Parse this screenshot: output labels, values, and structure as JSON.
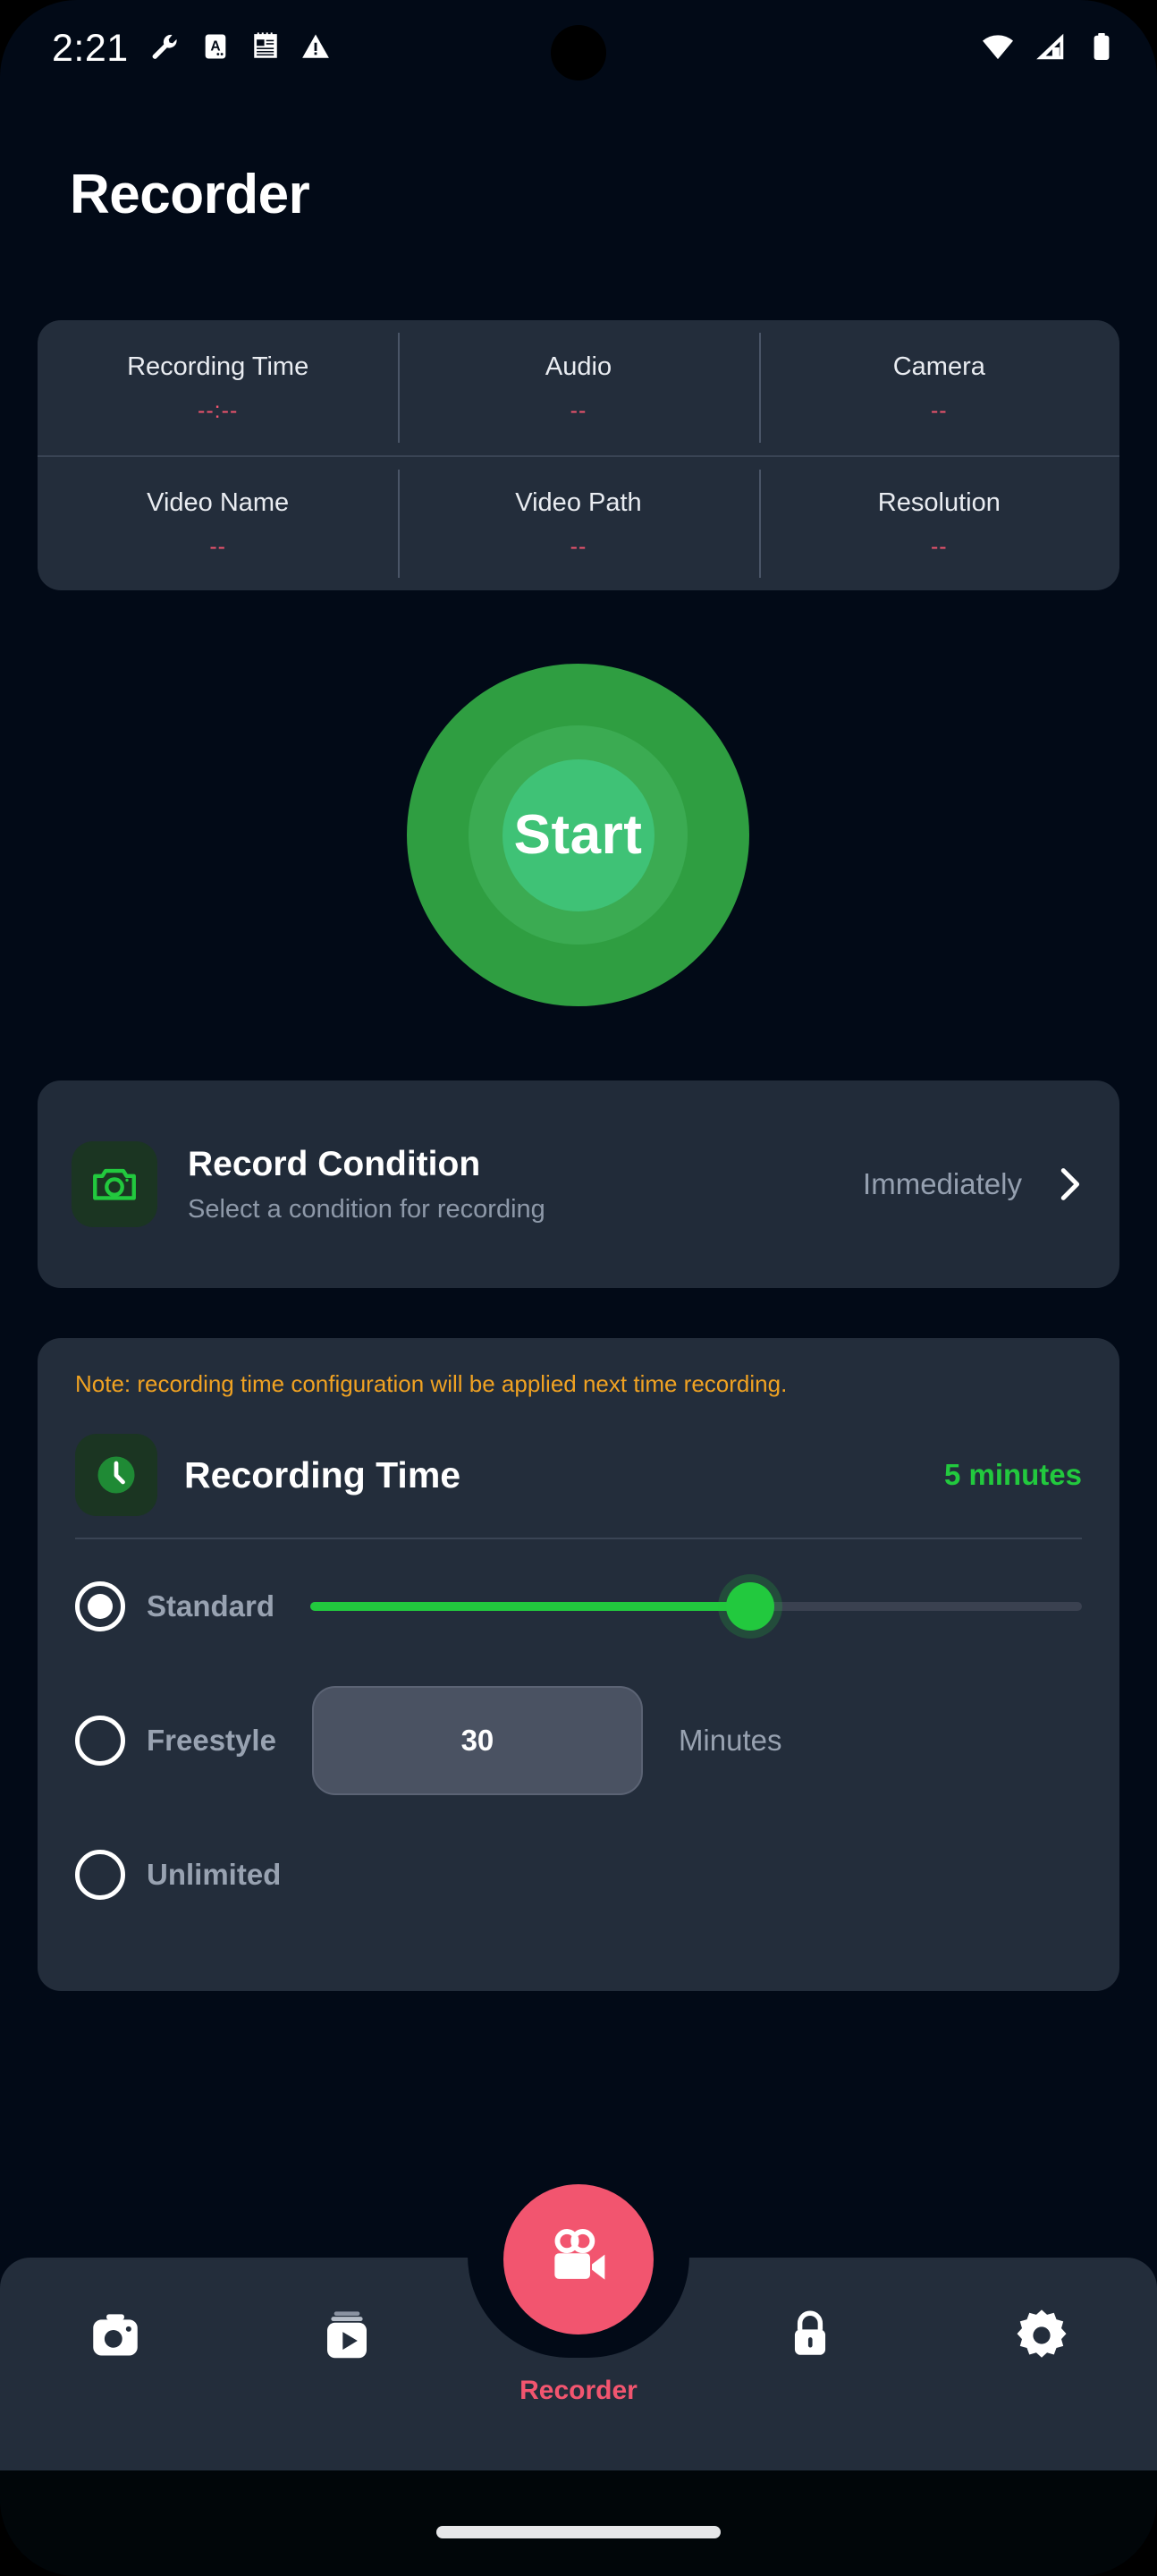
{
  "status_bar": {
    "clock": "2:21",
    "left_icons": [
      "wrench-icon",
      "assistant-badge-icon",
      "notes-icon",
      "warning-icon"
    ],
    "right_icons": [
      "wifi-icon",
      "cellular-signal-icon",
      "battery-icon"
    ]
  },
  "header": {
    "title": "Recorder"
  },
  "info_card": {
    "rows": [
      [
        {
          "label": "Recording Time",
          "value": "--:--"
        },
        {
          "label": "Audio",
          "value": "--"
        },
        {
          "label": "Camera",
          "value": "--"
        }
      ],
      [
        {
          "label": "Video Name",
          "value": "--"
        },
        {
          "label": "Video Path",
          "value": "--"
        },
        {
          "label": "Resolution",
          "value": "--"
        }
      ]
    ],
    "value_color": "#f2556f"
  },
  "start_button": {
    "label": "Start",
    "outer_color": "#2f9e41",
    "mid_color": "#3bab52",
    "inner_color": "#3fc276"
  },
  "record_condition": {
    "icon": "camera-icon",
    "title": "Record Condition",
    "subtitle": "Select a condition for recording",
    "value": "Immediately",
    "chevron": "chevron-right-icon",
    "accent_color": "#22c93e"
  },
  "recording_time": {
    "note": "Note: recording time configuration will be applied next time recording.",
    "note_color": "#f0a222",
    "icon": "clock-icon",
    "title": "Recording Time",
    "value": "5 minutes",
    "value_color": "#22c93e",
    "options": [
      {
        "id": "standard",
        "label": "Standard",
        "selected": true
      },
      {
        "id": "freestyle",
        "label": "Freestyle",
        "selected": false
      },
      {
        "id": "unlimited",
        "label": "Unlimited",
        "selected": false
      }
    ],
    "slider": {
      "percent": 57,
      "fill_color": "#22c93e",
      "track_color": "#3a4150"
    },
    "freestyle_input": {
      "value": "30",
      "placeholder": "30",
      "unit": "Minutes"
    }
  },
  "bottom_nav": {
    "items": [
      {
        "id": "camera",
        "icon": "camera-icon",
        "label": "",
        "active": false
      },
      {
        "id": "gallery",
        "icon": "video-play-icon",
        "label": "",
        "active": false
      },
      {
        "id": "recorder",
        "icon": "video-camera-icon",
        "label": "Recorder",
        "active": true
      },
      {
        "id": "lock",
        "icon": "lock-icon",
        "label": "",
        "active": false
      },
      {
        "id": "settings",
        "icon": "gear-icon",
        "label": "",
        "active": false
      }
    ],
    "active_color": "#f2556f"
  }
}
